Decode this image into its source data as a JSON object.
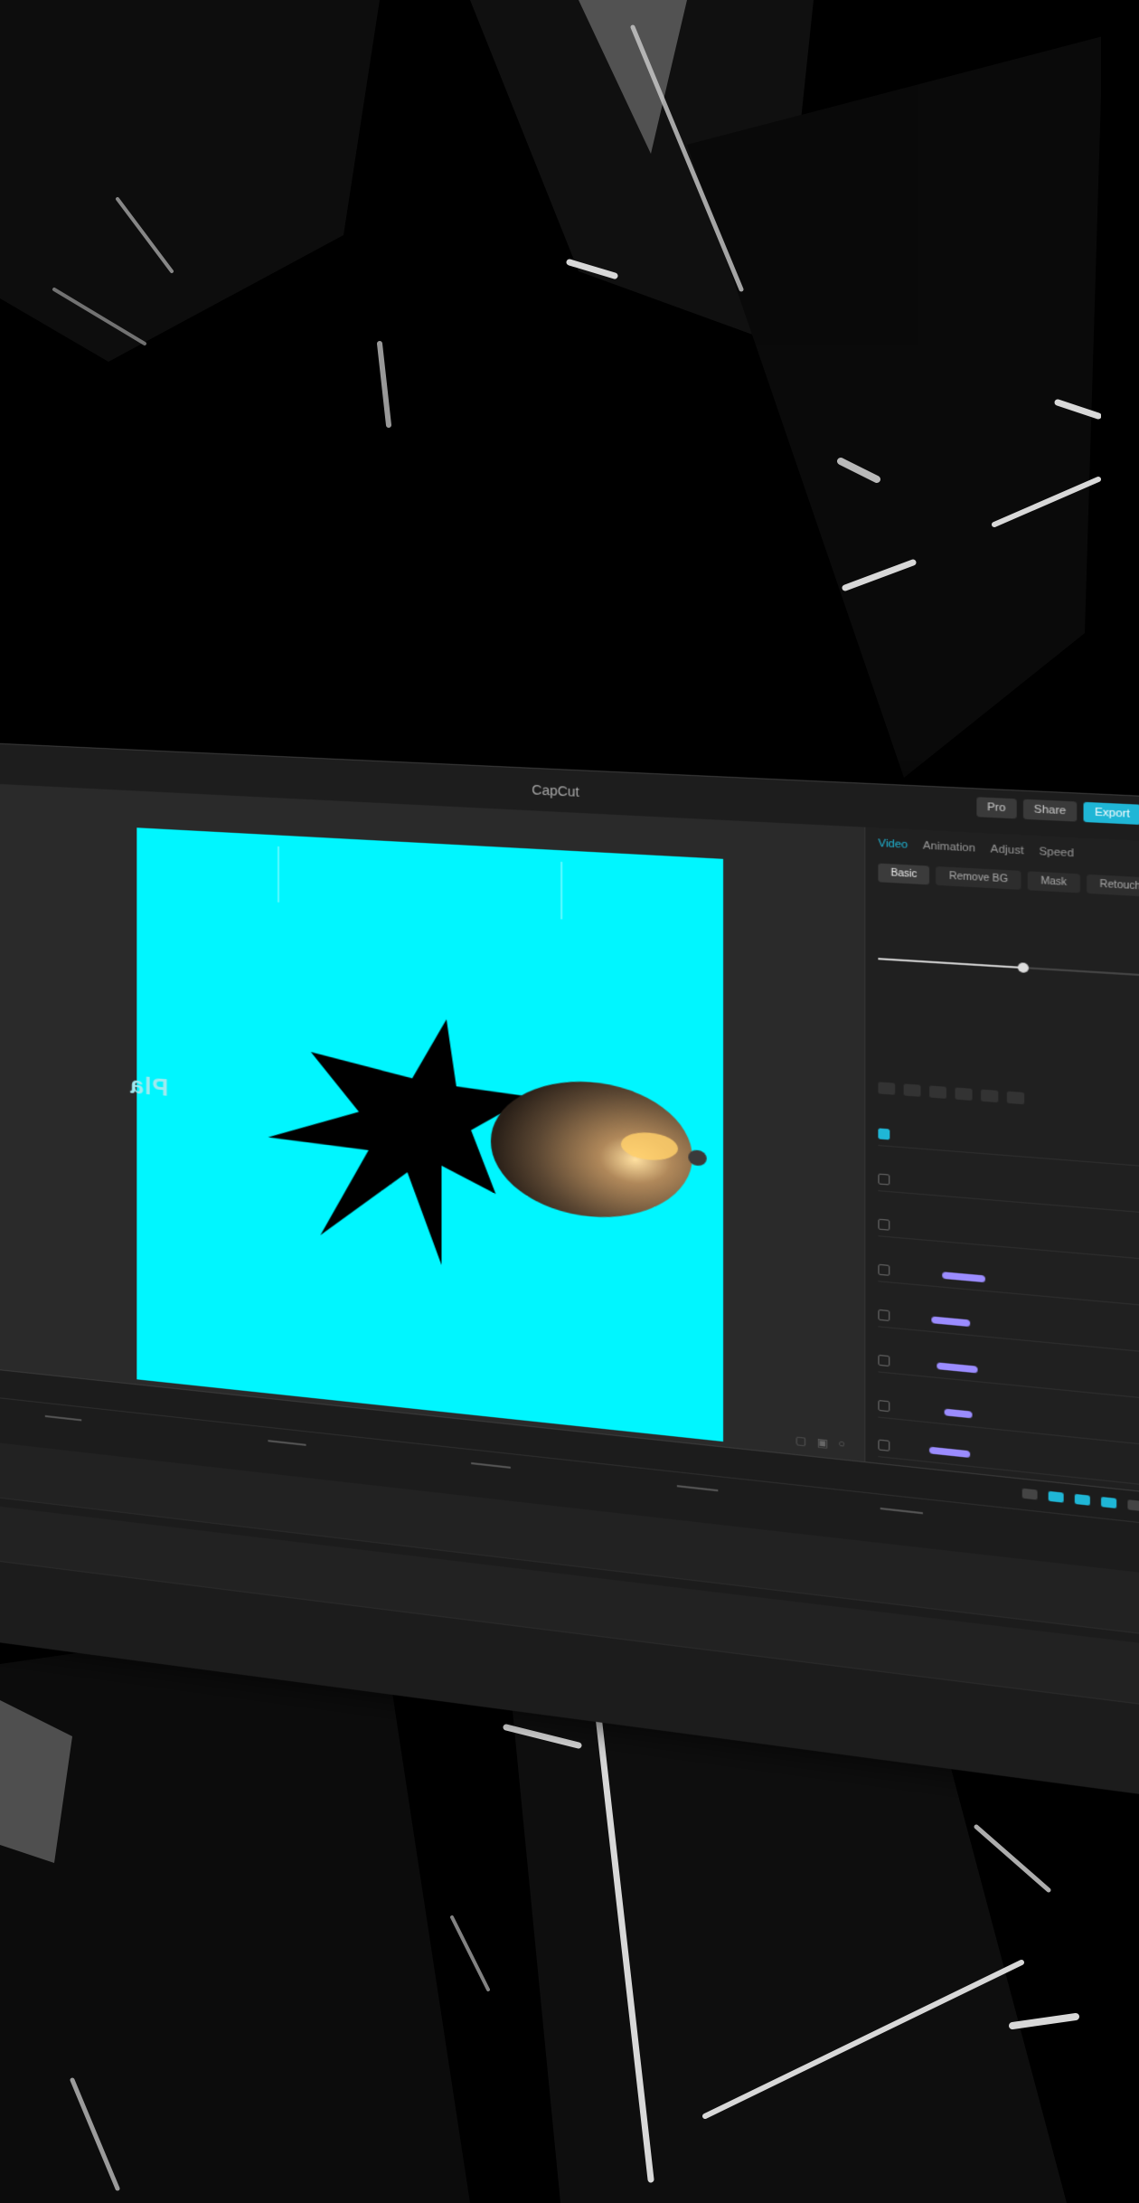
{
  "window": {
    "title": "CapCut"
  },
  "top_actions": {
    "pro_label": "Pro",
    "share_label": "Share",
    "export_label": "Export"
  },
  "preview": {
    "canvas_color": "#00f6ff",
    "side_text": "Pla"
  },
  "inspector": {
    "tabs": [
      "Video",
      "Animation",
      "Adjust",
      "Speed"
    ],
    "subtabs": [
      "Basic",
      "Remove BG",
      "Mask",
      "Retouch"
    ]
  },
  "colors": {
    "accent": "#1fb6d6",
    "effect_bar": "#9b8cff",
    "panel_bg": "#262626"
  }
}
